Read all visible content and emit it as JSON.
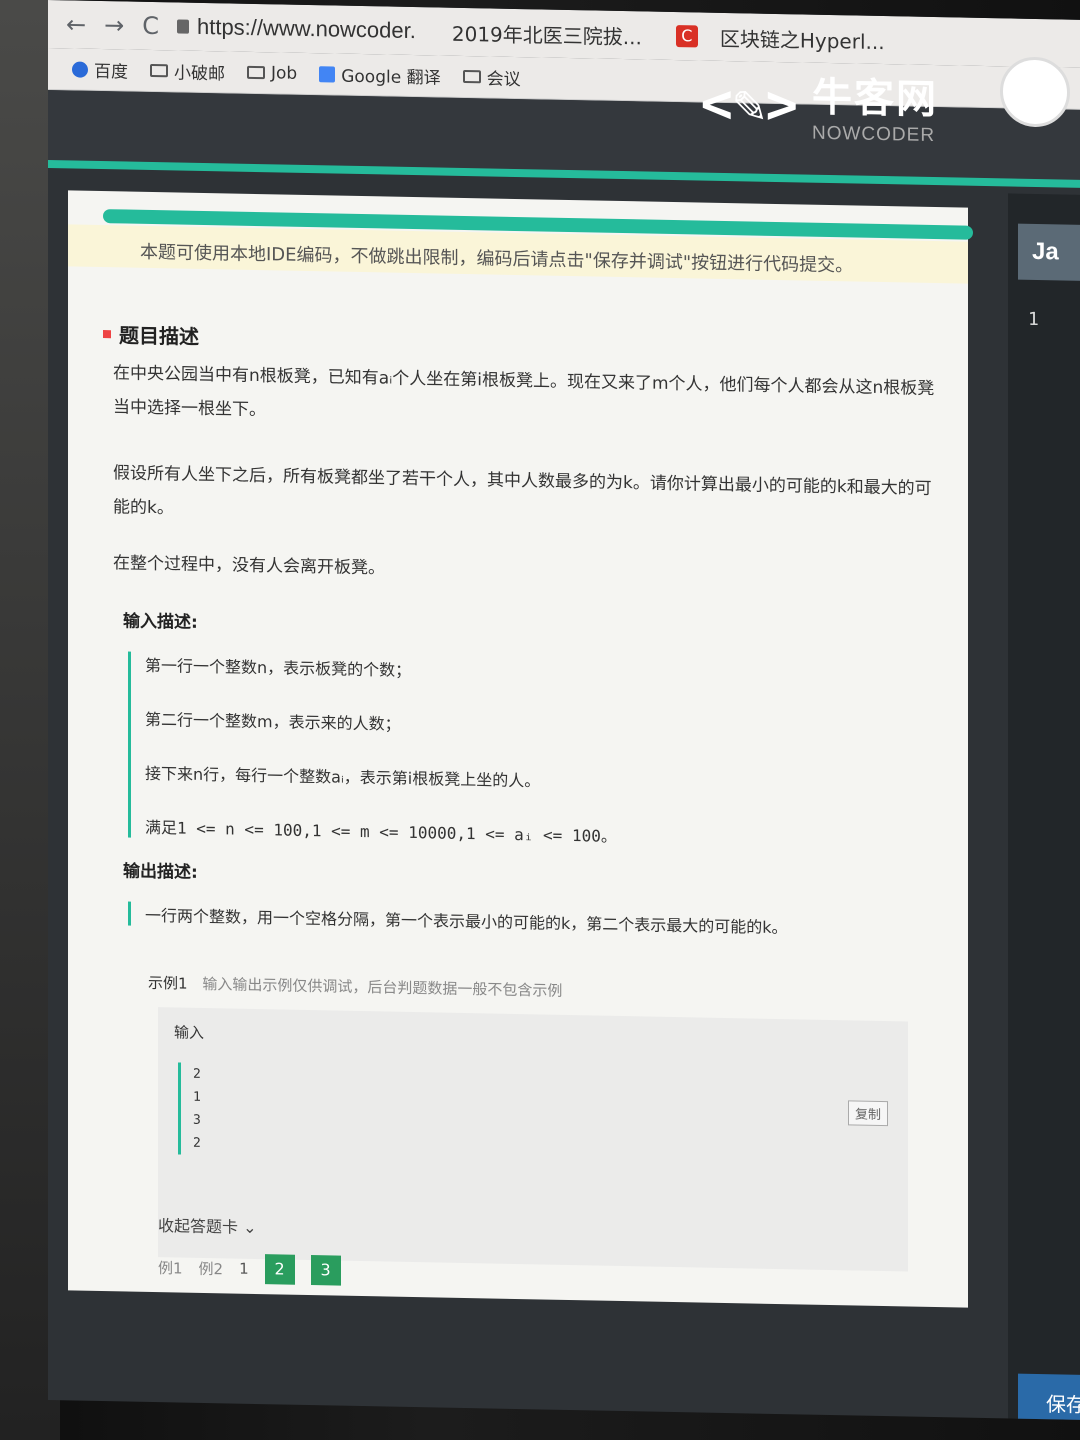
{
  "browser": {
    "url": "https://www.nowcoder.",
    "tab_title": "2019年北医三院拔...",
    "tab_title_2": "区块链之Hyperl..."
  },
  "bookmarks": [
    {
      "label": "百度",
      "icon": "paw-icon"
    },
    {
      "label": "小破邮",
      "icon": "folder-icon"
    },
    {
      "label": "Job",
      "icon": "folder-icon"
    },
    {
      "label": "Google 翻译",
      "icon": "translate-icon"
    },
    {
      "label": "会议",
      "icon": "folder-icon"
    }
  ],
  "site": {
    "logo_cn": "牛客网",
    "logo_en": "NOWCODER"
  },
  "editor": {
    "language": "Ja",
    "line_number": "1",
    "save_label": "保存并调试"
  },
  "notice": "本题可使用本地IDE编码，不做跳出限制，编码后请点击\"保存并调试\"按钮进行代码提交。",
  "problem": {
    "section_title": "题目描述",
    "paragraph1": "在中央公园当中有n根板凳，已知有aᵢ个人坐在第i根板凳上。现在又来了m个人，他们每个人都会从这n根板凳当中选择一根坐下。",
    "paragraph2": "假设所有人坐下之后，所有板凳都坐了若干个人，其中人数最多的为k。请你计算出最小的可能的k和最大的可能的k。",
    "paragraph3": "在整个过程中，没有人会离开板凳。",
    "input_title": "输入描述:",
    "input_lines": [
      "第一行一个整数n，表示板凳的个数；",
      "第二行一个整数m，表示来的人数；",
      "接下来n行，每行一个整数aᵢ，表示第i根板凳上坐的人。",
      "满足1 <= n <= 100,1 <= m <= 10000,1 <= aᵢ <= 100。"
    ],
    "output_title": "输出描述:",
    "output_line": "一行两个整数，用一个空格分隔，第一个表示最小的可能的k，第二个表示最大的可能的k。"
  },
  "example": {
    "title": "示例1",
    "hint": "输入输出示例仅供调试，后台判题数据一般不包含示例",
    "input_label": "输入",
    "input_values": [
      "2",
      "1",
      "3",
      "2"
    ],
    "copy_label": "复制"
  },
  "answer_card": {
    "collapse_label": "收起答题卡",
    "items": [
      "例1",
      "例2",
      "1"
    ],
    "active_items": [
      "2",
      "3"
    ]
  }
}
